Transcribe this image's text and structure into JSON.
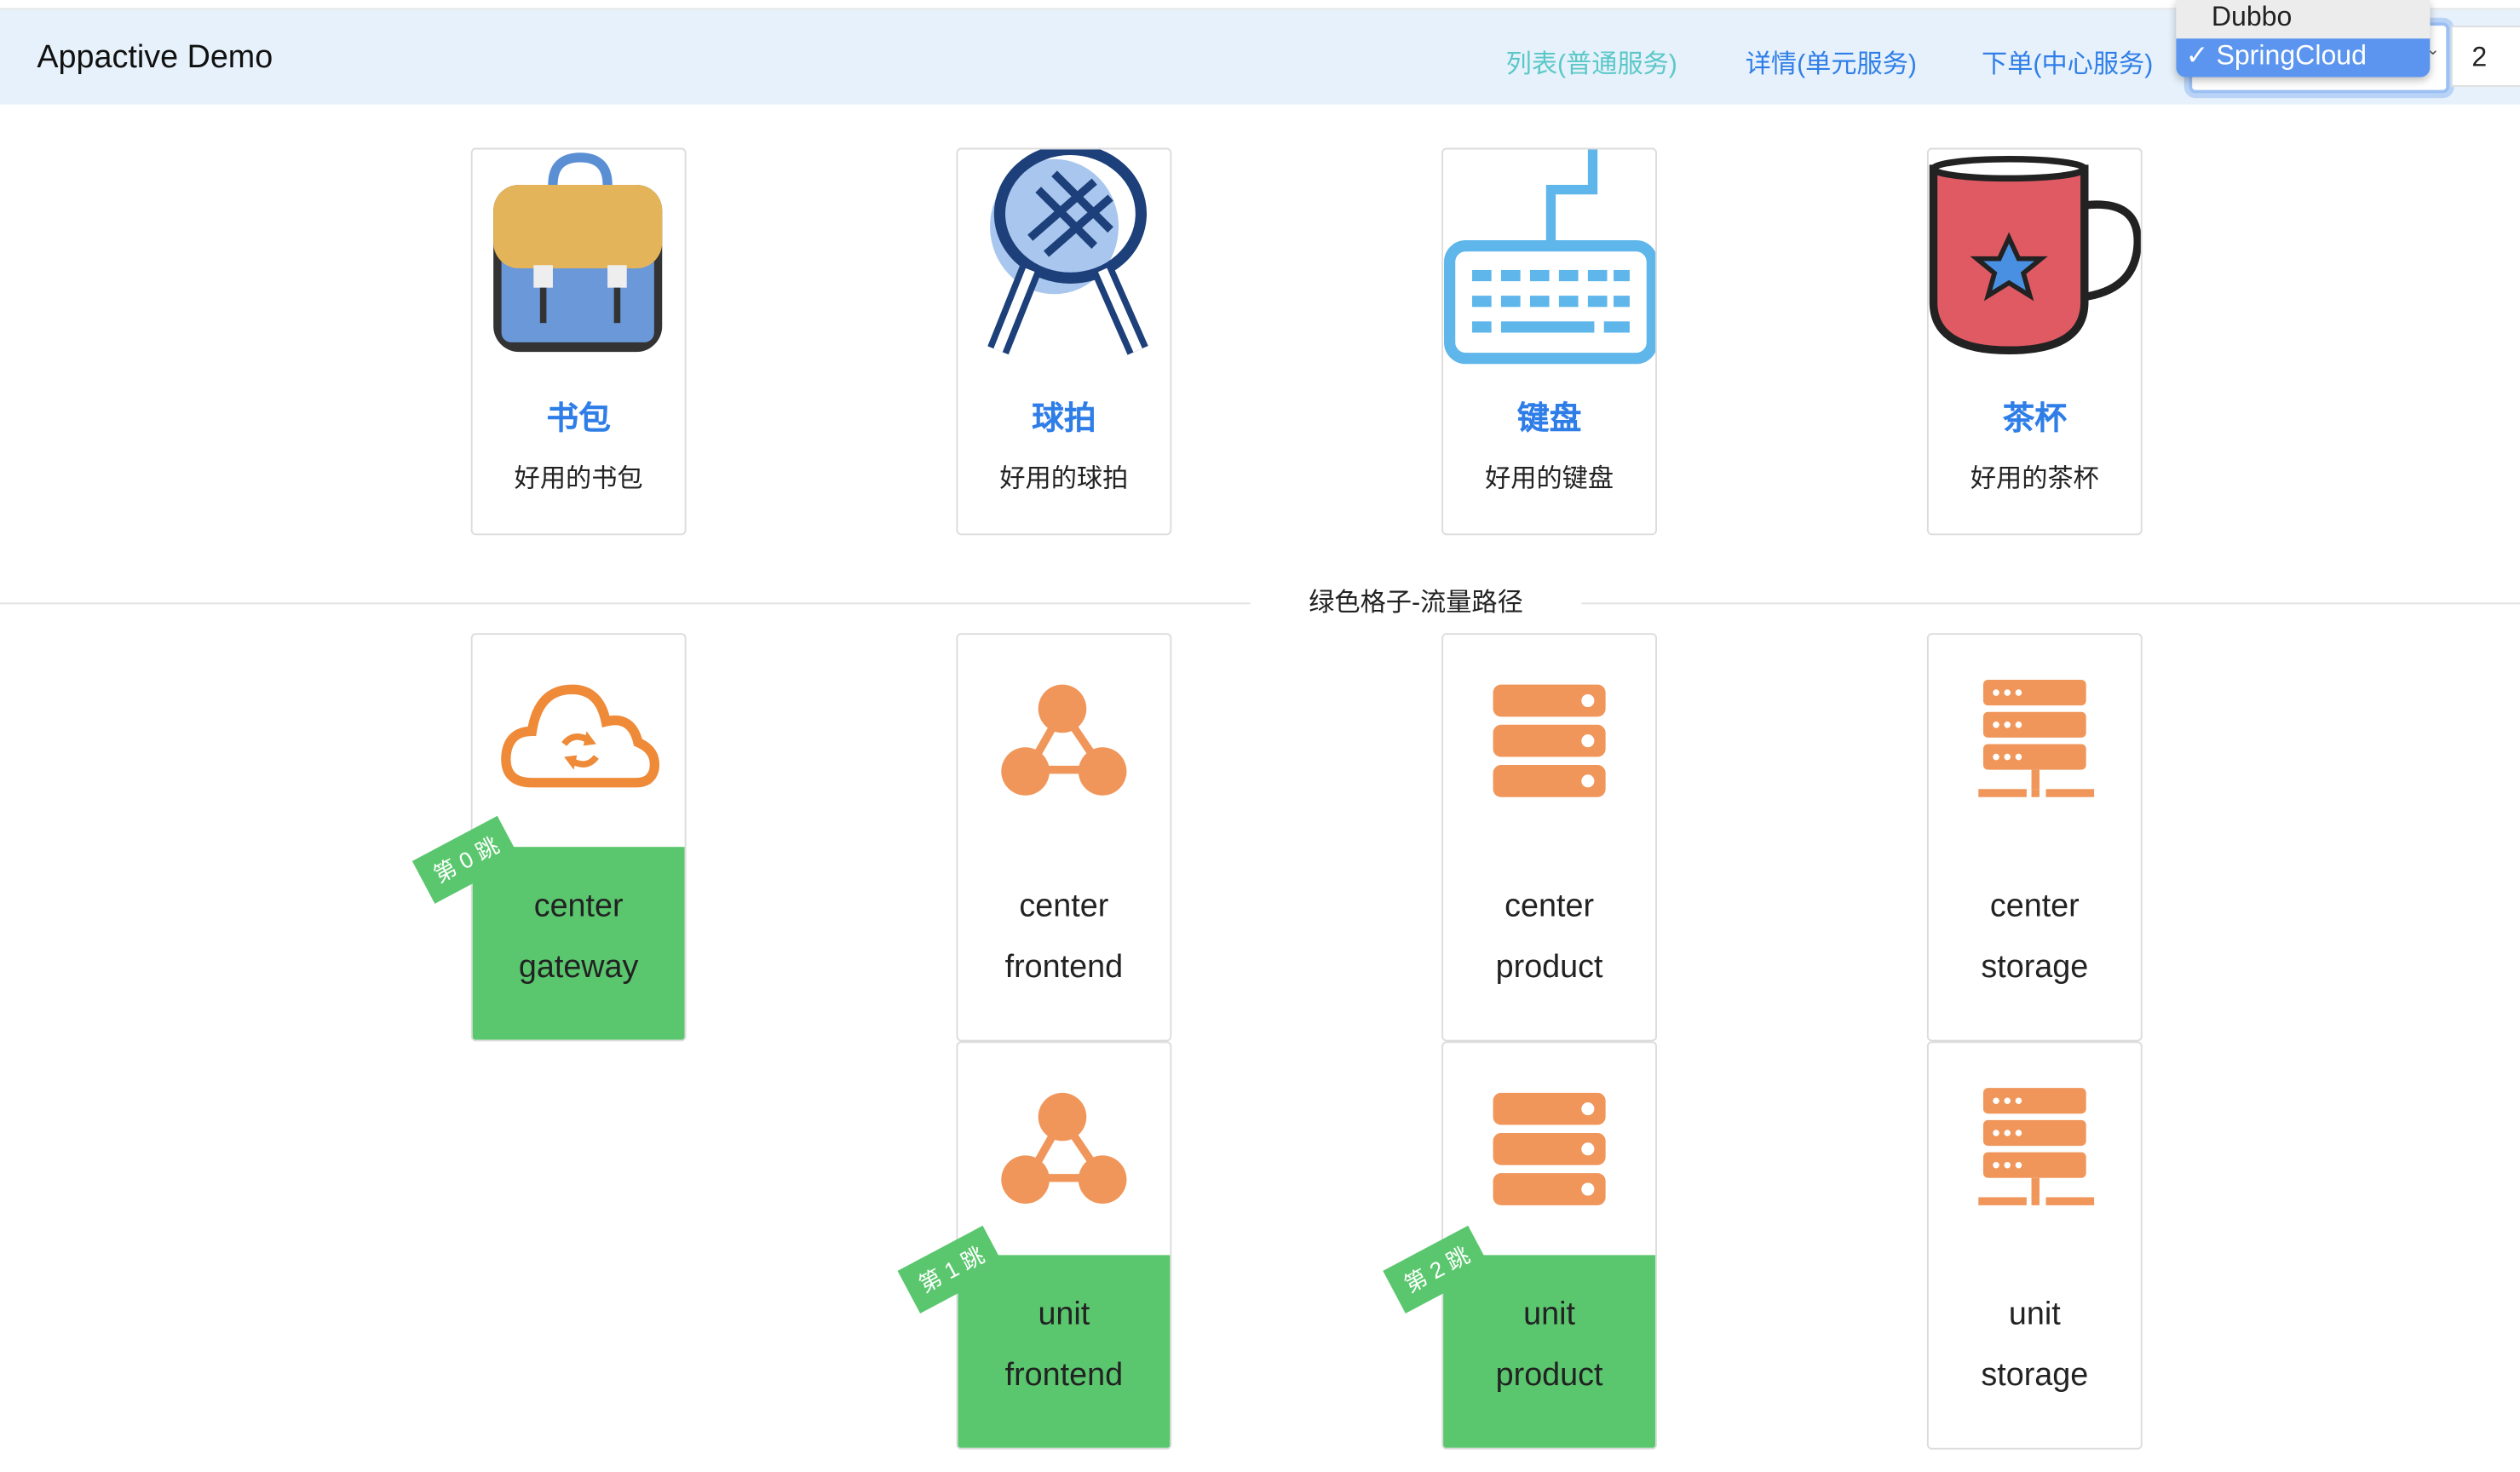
{
  "header": {
    "title": "Appactive Demo",
    "nav": [
      {
        "label": "列表(普通服务)",
        "color": "#5bc8c8"
      },
      {
        "label": "详情(单元服务)",
        "color": "#2f7ee8"
      },
      {
        "label": "下单(中心服务)",
        "color": "#2f7ee8"
      }
    ],
    "framework_select": {
      "options": [
        "Dubbo",
        "SpringCloud"
      ],
      "selected": "SpringCloud",
      "check": "✓"
    },
    "number_input": "2"
  },
  "products": [
    {
      "title": "书包",
      "desc": "好用的书包",
      "icon": "backpack-icon"
    },
    {
      "title": "球拍",
      "desc": "好用的球拍",
      "icon": "racket-icon"
    },
    {
      "title": "键盘",
      "desc": "好用的键盘",
      "icon": "keyboard-icon"
    },
    {
      "title": "茶杯",
      "desc": "好用的茶杯",
      "icon": "mug-icon"
    }
  ],
  "divider_label": "绿色格子-流量路径",
  "services": [
    {
      "line1": "center",
      "line2": "gateway",
      "icon": "cloud-sync-icon",
      "active": true,
      "hop": "第 0 跳"
    },
    {
      "line1": "center",
      "line2": "frontend",
      "icon": "network-icon",
      "active": false
    },
    {
      "line1": "center",
      "line2": "product",
      "icon": "server-icon",
      "active": false
    },
    {
      "line1": "center",
      "line2": "storage",
      "icon": "storage-icon",
      "active": false
    },
    {
      "line1": "unit",
      "line2": "frontend",
      "icon": "network-icon",
      "active": true,
      "hop": "第 1 跳"
    },
    {
      "line1": "unit",
      "line2": "product",
      "icon": "server-icon",
      "active": true,
      "hop": "第 2 跳"
    },
    {
      "line1": "unit",
      "line2": "storage",
      "icon": "storage-icon",
      "active": false
    }
  ],
  "colors": {
    "active": "#5ac76e",
    "icon": "#f0965a",
    "link": "#2f7ee8",
    "header_bg": "#e6f1fb"
  }
}
